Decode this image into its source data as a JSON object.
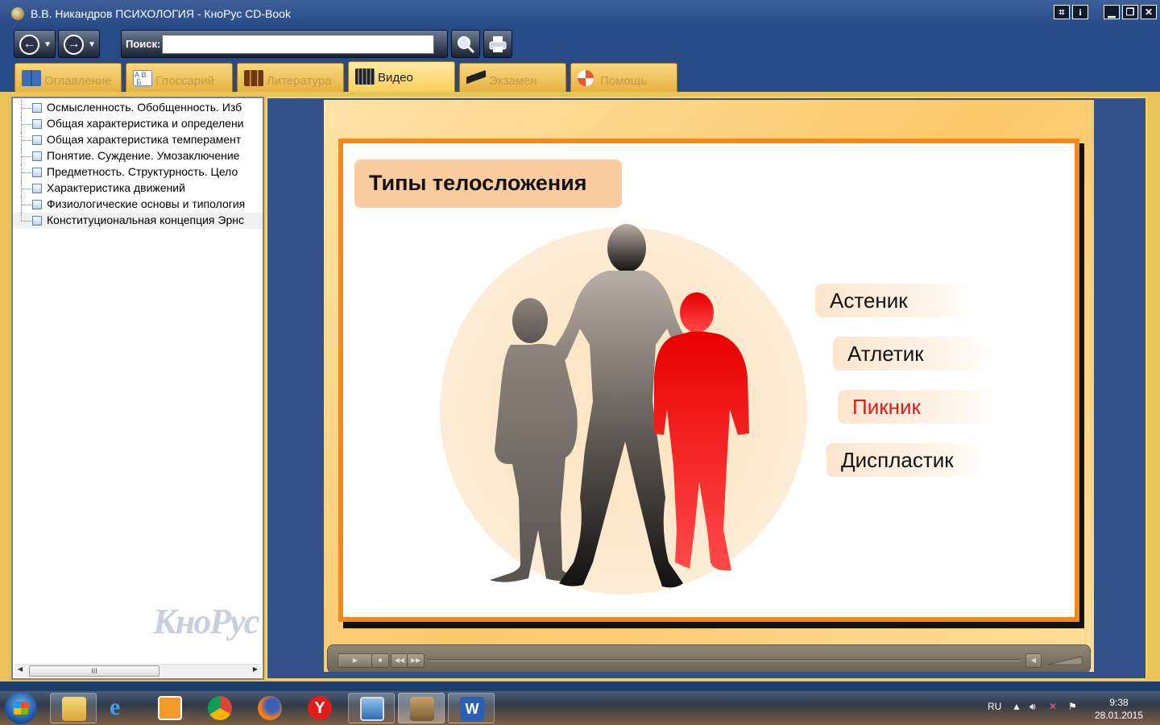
{
  "window": {
    "title": "В.В. Никандров ПСИХОЛОГИЯ - КноРус CD-Book",
    "controls": [
      "⌗",
      "i",
      "▁",
      "❐",
      "✕"
    ]
  },
  "toolbar": {
    "back_icon": "arrow-left-icon",
    "forward_icon": "arrow-right-icon",
    "search_label": "Поиск:",
    "search_value": "",
    "search_button_icon": "magnifier-icon",
    "print_button_icon": "printer-icon"
  },
  "tabs": [
    {
      "label": "Оглавление",
      "icon": "book-icon"
    },
    {
      "label": "Глоссарий",
      "icon": "abc-icon"
    },
    {
      "label": "Литература",
      "icon": "books-icon"
    },
    {
      "label": "Видео",
      "icon": "film-icon",
      "active": true
    },
    {
      "label": "Экзамен",
      "icon": "graduation-cap-icon"
    },
    {
      "label": "Помощь",
      "icon": "lifebuoy-icon"
    }
  ],
  "sidebar": {
    "items": [
      {
        "label": "Осмысленность. Обобщенность. Изб"
      },
      {
        "label": "Общая характеристика и определени"
      },
      {
        "label": "Общая характеристика темперамент"
      },
      {
        "label": "Понятие. Суждение. Умозаключение"
      },
      {
        "label": "Предметность. Структурность. Цело"
      },
      {
        "label": "Характеристика движений"
      },
      {
        "label": "Физиологические основы и типология"
      },
      {
        "label": "Конституциональная концепция Эрнс",
        "selected": true
      }
    ],
    "watermark": "КноРус",
    "scroll_thumb_label": "III"
  },
  "slide": {
    "title": "Типы телосложения",
    "types": [
      {
        "label": "Астеник",
        "highlighted": false
      },
      {
        "label": "Атлетик",
        "highlighted": false
      },
      {
        "label": "Пикник",
        "highlighted": true
      },
      {
        "label": "Диспластик",
        "highlighted": false
      }
    ],
    "figure_colors": {
      "asthenic": "#7a7470",
      "athletic": "#3a3633",
      "pyknic": "#ee1c1c"
    }
  },
  "player": {
    "play_icon": "play-icon",
    "stop_icon": "stop-icon",
    "rewind_icon": "rewind-icon",
    "forward_icon": "fast-forward-icon",
    "volume_icon": "speaker-icon",
    "progress": 0
  },
  "taskbar": {
    "apps": [
      "explorer",
      "internet-explorer",
      "media-player",
      "chrome",
      "firefox",
      "yandex-browser",
      "photo-viewer",
      "knorus-cd-book",
      "word"
    ],
    "language": "RU",
    "time": "9:38",
    "date": "28.01.2015"
  },
  "colors": {
    "accent": "#f08a1c",
    "tab_bg": "#fbcf5a",
    "window_frame": "#284a86",
    "highlight_text": "#e01a1a"
  }
}
